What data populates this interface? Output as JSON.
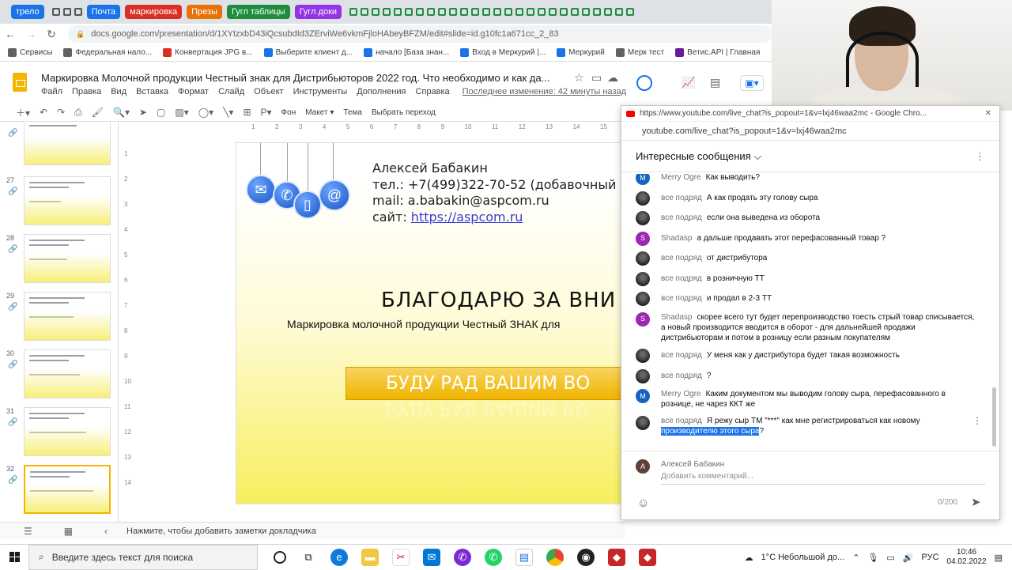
{
  "browser": {
    "tabs": [
      {
        "label": "трело",
        "color": "#1a73e8"
      },
      {
        "label": "Почта",
        "color": "#1a73e8"
      },
      {
        "label": "маркировка",
        "color": "#d93025"
      },
      {
        "label": "Презы",
        "color": "#e8710a"
      },
      {
        "label": "Гугл таблицы",
        "color": "#1e8e3e"
      },
      {
        "label": "Гугл доки",
        "color": "#9334e6"
      }
    ],
    "url": "docs.google.com/presentation/d/1XYtzxbD43iQcsubdId3ZErviWe6vkmFjloHAbeyBFZM/edit#slide=id.g10fc1a671cc_2_83",
    "bookmarks": [
      {
        "label": "Сервисы",
        "color": "#5f6368"
      },
      {
        "label": "Федеральная нало...",
        "color": "#5f6368"
      },
      {
        "label": "Конвертация JPG в...",
        "color": "#d93025"
      },
      {
        "label": "Выберите клиент д...",
        "color": "#1a73e8"
      },
      {
        "label": "начало [База знан...",
        "color": "#1a73e8"
      },
      {
        "label": "Вход в Меркурий |...",
        "color": "#1a73e8"
      },
      {
        "label": "Меркурий",
        "color": "#1a73e8"
      },
      {
        "label": "Мерк тест",
        "color": "#5f6368"
      },
      {
        "label": "Ветис.API | Главная",
        "color": "#6a1b9a"
      }
    ]
  },
  "slides_app": {
    "title": "Маркировка Молочной продукции Честный знак для Дистрибьюторов 2022 год. Что необходимо и как да...",
    "menu": [
      "Файл",
      "Правка",
      "Вид",
      "Вставка",
      "Формат",
      "Слайд",
      "Объект",
      "Инструменты",
      "Дополнения",
      "Справка"
    ],
    "last_edit": "Последнее изменение: 42 минуты назад",
    "toolbar": {
      "background": "Фон",
      "layout": "Макет ▾",
      "theme": "Тема",
      "transition": "Выбрать переход"
    },
    "thumbnails": [
      {
        "num": "27"
      },
      {
        "num": "28"
      },
      {
        "num": "29"
      },
      {
        "num": "30"
      },
      {
        "num": "31"
      },
      {
        "num": "32"
      }
    ],
    "slide": {
      "name": "Алексей Бабакин",
      "phone": "тел.: +7(499)322-70-52 (добавочный",
      "mail": "mail: a.babakin@aspcom.ru",
      "site_label": "сайт: ",
      "site_link": "https://aspcom.ru",
      "thanks": "БЛАГОДАРЮ ЗА ВНИ",
      "subtitle": "Маркировка молочной продукции Честный ЗНАК для",
      "banner": "БУДУ РАД ВАШИМ ВО"
    },
    "notes_placeholder": "Нажмите, чтобы добавить заметки докладчика"
  },
  "chat": {
    "window_title": "https://www.youtube.com/live_chat?is_popout=1&v=lxj46waa2mc - Google Chro...",
    "address": "youtube.com/live_chat?is_popout=1&v=lxj46waa2mc",
    "header": "Интересные сообщения",
    "messages": [
      {
        "avatar": "M",
        "avatar_color": "#1565c0",
        "author": "Merry Ogre",
        "text": "Как выводить?"
      },
      {
        "avatar": "",
        "avatar_color": "",
        "author": "все подряд",
        "text": "А как продать эту голову сыра"
      },
      {
        "avatar": "",
        "avatar_color": "",
        "author": "все подряд",
        "text": "если она выведена из оборота"
      },
      {
        "avatar": "S",
        "avatar_color": "#9c27b0",
        "author": "Shadasp",
        "text": "а дальше продавать этот перефасованный товар ?"
      },
      {
        "avatar": "",
        "avatar_color": "",
        "author": "все подряд",
        "text": "от дистрибутора"
      },
      {
        "avatar": "",
        "avatar_color": "",
        "author": "все подряд",
        "text": "в розничную ТТ"
      },
      {
        "avatar": "",
        "avatar_color": "",
        "author": "все подряд",
        "text": "и продал в 2-3 ТТ"
      },
      {
        "avatar": "S",
        "avatar_color": "#9c27b0",
        "author": "Shadasp",
        "text": "скорее всего тут будет перепроизводство тоесть стрый товар списывается, а новый производится вводится в оборот - для дальнейшей продажи дистрибьюторам и потом в розницу если разным покупателям"
      },
      {
        "avatar": "",
        "avatar_color": "",
        "author": "все подряд",
        "text": "У меня как у дистрибутора будет такая возможность"
      },
      {
        "avatar": "",
        "avatar_color": "",
        "author": "все подряд",
        "text": "?"
      },
      {
        "avatar": "M",
        "avatar_color": "#1565c0",
        "author": "Merry Ogre",
        "text": "Каким документом мы выводим голову сыра, перефасованного в рознице, не чарез ККТ же"
      },
      {
        "avatar": "",
        "avatar_color": "",
        "author": "все подряд",
        "text": "Я режу сыр ТМ \"***\" как мне регистрироваться как новому ",
        "highlight": "производителю этого сыра",
        "tail": "?"
      }
    ],
    "composer": {
      "avatar": "А",
      "name": "Алексей Бабакин",
      "placeholder": "Добавить комментарий...",
      "counter": "0/200"
    }
  },
  "taskbar": {
    "search_placeholder": "Введите здесь текст для поиска",
    "weather": "1°C  Небольшой до...",
    "lang": "РУС",
    "time": "10:46",
    "date": "04.02.2022"
  }
}
